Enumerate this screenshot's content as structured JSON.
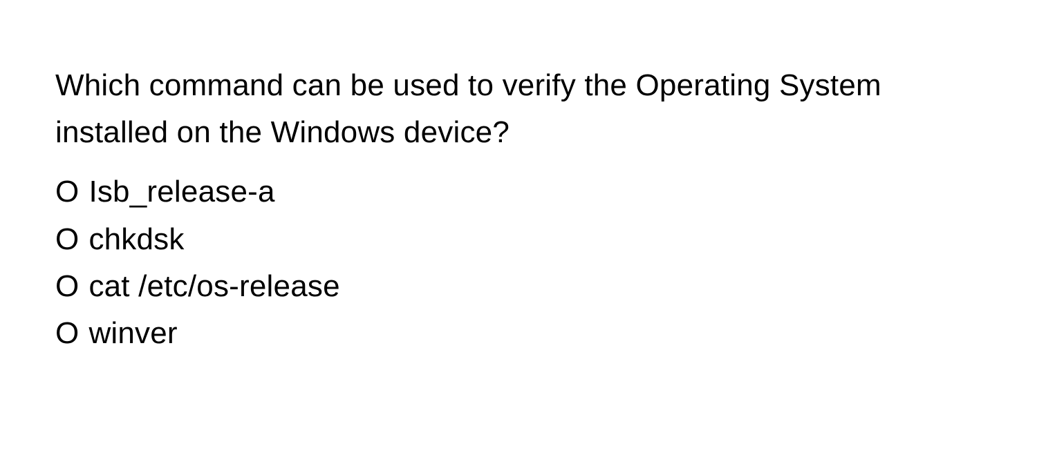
{
  "question": {
    "text": "Which command can be used to verify the Operating System installed on the Windows device?"
  },
  "options": [
    {
      "marker": "O",
      "label": "Isb_release-a"
    },
    {
      "marker": "O",
      "label": "chkdsk"
    },
    {
      "marker": "O",
      "label": "cat /etc/os-release"
    },
    {
      "marker": "O",
      "label": "winver"
    }
  ]
}
